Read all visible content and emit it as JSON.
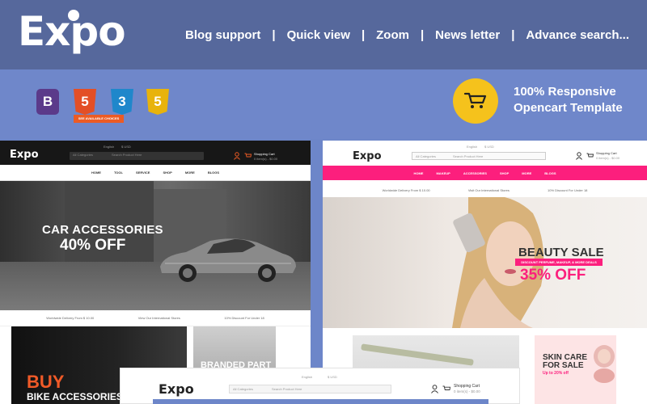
{
  "brand": {
    "name_e": "E",
    "name_x": "x",
    "name_po": "po"
  },
  "features_nav": [
    "Blog support",
    "Quick view",
    "Zoom",
    "News letter",
    "Advance search..."
  ],
  "separators": [
    "|",
    "|",
    "|",
    "|"
  ],
  "tech_badges": [
    {
      "name": "bootstrap-icon",
      "letter": "B",
      "color": "#5b3a8a"
    },
    {
      "name": "html5-icon",
      "letter": "5",
      "color": "#e34f26"
    },
    {
      "name": "css3-icon",
      "letter": "3",
      "color": "#1f87cb"
    },
    {
      "name": "js5-icon",
      "letter": "5",
      "color": "#e8b30c"
    }
  ],
  "responsive": {
    "line1": "100% Responsive",
    "line2": "Opencart Template"
  },
  "mock_left": {
    "logo": "Expo",
    "search_category": "All Categories",
    "search_placeholder": "Search Product Here",
    "lang": "English",
    "currency": "$ USD",
    "cart_title": "Shopping Cart",
    "cart_sub": "0 item(s) - $0.00",
    "nav": [
      "HOME",
      "TOOL",
      "SERVICE",
      "SHOP",
      "MORE",
      "BLOGS"
    ],
    "hero_line1": "CAR ACCESSORIES",
    "hero_line2": "40% OFF",
    "hero_button": "SEE AVAILABLE CHOICES",
    "info": [
      "Worldwide Delivery From $ 10.00",
      "View Our International Stores",
      "10% Discount For Under 18"
    ],
    "promo1_line1": "BUY",
    "promo1_line2": "BIKE ACCESSORIES",
    "promo2": "BRANDED PART"
  },
  "mock_right": {
    "logo": "Expo",
    "search_category": "All Categories",
    "search_placeholder": "Search Product Here",
    "lang": "English",
    "currency": "$ USD",
    "cart_title": "Shopping Cart",
    "cart_sub": "0 item(s) - $0.00",
    "nav": [
      "HOME",
      "MAKEUP",
      "ACCESSORIES",
      "SHOP",
      "MORE",
      "BLOGS"
    ],
    "info": [
      "Worldwide Delivery From $ 10.00",
      "Visit Our International Stores",
      "10% Discount For Under 18"
    ],
    "hero_line1": "BEAUTY SALE",
    "hero_tag": "DISCOUNT PERFUME, MAKEUP, & MORE DEALS",
    "hero_line2": "35% OFF",
    "promo2_line1": "SKIN CARE",
    "promo2_line2": "FOR SALE",
    "promo2_sub": "Up to 20% off"
  },
  "mock_bottom": {
    "logo": "Expo",
    "search_category": "All Categories",
    "search_placeholder": "Search Product Here",
    "lang": "English",
    "currency": "$ USD",
    "cart_title": "Shopping Cart",
    "cart_sub": "0 item(s) - $0.00"
  }
}
